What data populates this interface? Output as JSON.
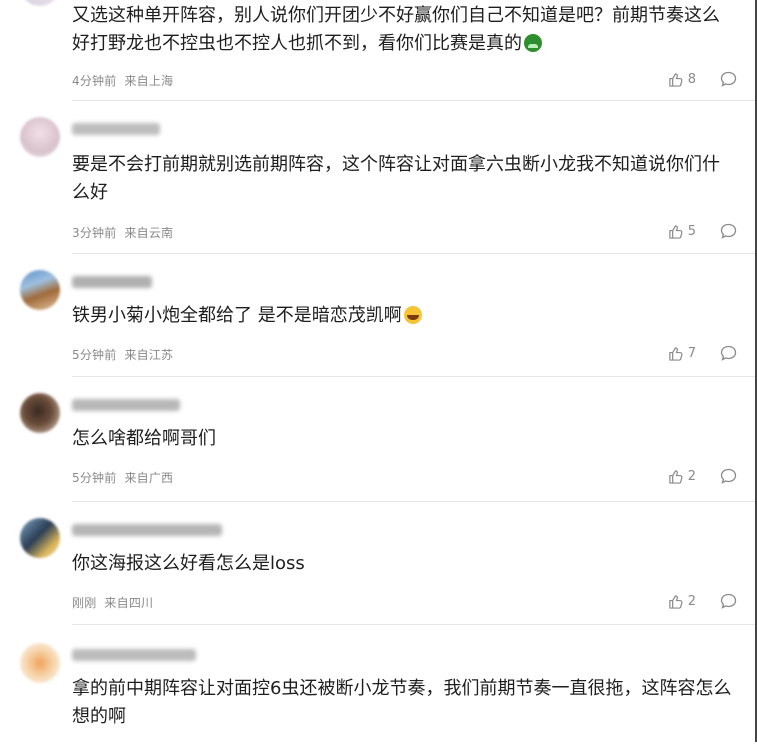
{
  "comments": [
    {
      "text": "又选这种单开阵容，别人说你们开团少不好赢你们自己不知道是吧？前期节奏这么好打野龙也不控虫也不控人也抓不到，看你们比赛是真的",
      "emoji": "sick-face-emoji",
      "time": "4分钟前",
      "location": "来自上海",
      "likes": "8"
    },
    {
      "text": "要是不会打前期就别选前期阵容，这个阵容让对面拿六虫断小龙我不知道说你们什么好",
      "time": "3分钟前",
      "location": "来自云南",
      "likes": "5"
    },
    {
      "text": "铁男小菊小炮全都给了 是不是暗恋茂凯啊",
      "emoji": "laughing-emoji",
      "time": "5分钟前",
      "location": "来自江苏",
      "likes": "7"
    },
    {
      "text": "怎么啥都给啊哥们",
      "time": "5分钟前",
      "location": "来自广西",
      "likes": "2"
    },
    {
      "text": "你这海报这么好看怎么是loss",
      "time": "刚刚",
      "location": "来自四川",
      "likes": "2"
    },
    {
      "text": "拿的前中期阵容让对面控6虫还被断小龙节奏，我们前期节奏一直很拖，这阵容怎么想的啊"
    }
  ],
  "colors": {
    "text": "#1e1e1e",
    "meta": "#8a8a8a",
    "divider": "#e6e6e6"
  }
}
